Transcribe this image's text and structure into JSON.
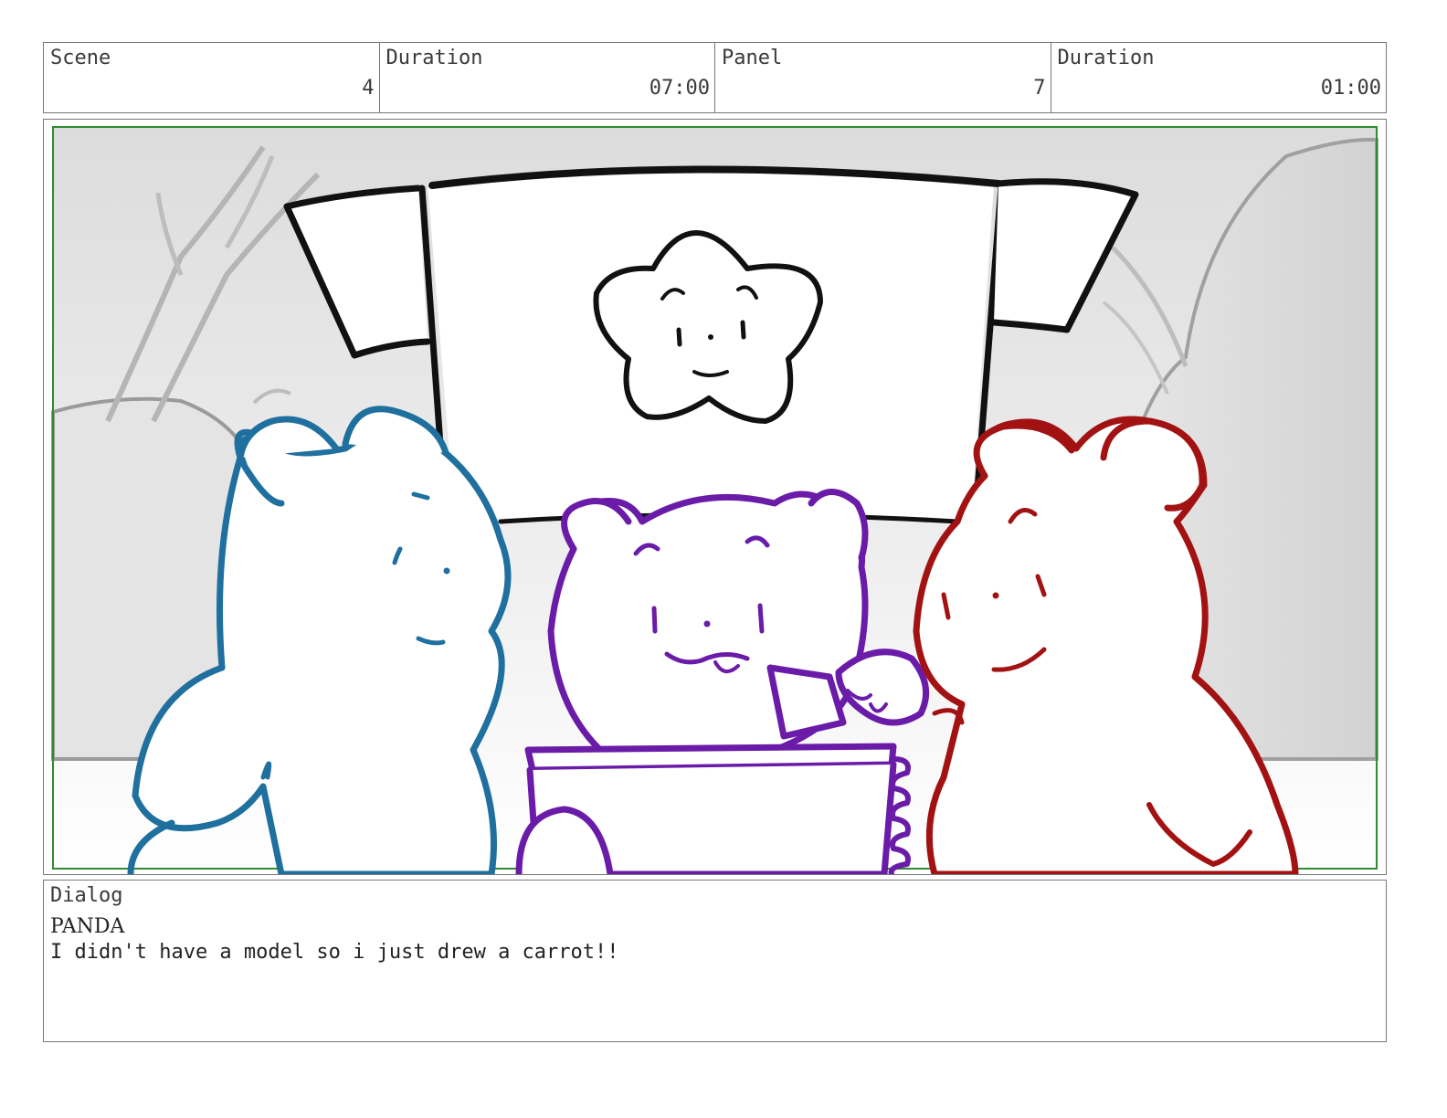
{
  "header": {
    "scene_label": "Scene",
    "scene_value": "4",
    "scene_duration_label": "Duration",
    "scene_duration_value": "07:00",
    "panel_label": "Panel",
    "panel_value": "7",
    "panel_duration_label": "Duration",
    "panel_duration_value": "01:00"
  },
  "dialog": {
    "label": "Dialog",
    "speaker": "PANDA",
    "line": "I didn't have a model so i just drew a carrot!!"
  },
  "colors": {
    "blue_bear": "#1f6f9f",
    "purple_bear": "#6a1ba8",
    "red_bear": "#a31212",
    "frame_guide": "#2e8b2e"
  }
}
